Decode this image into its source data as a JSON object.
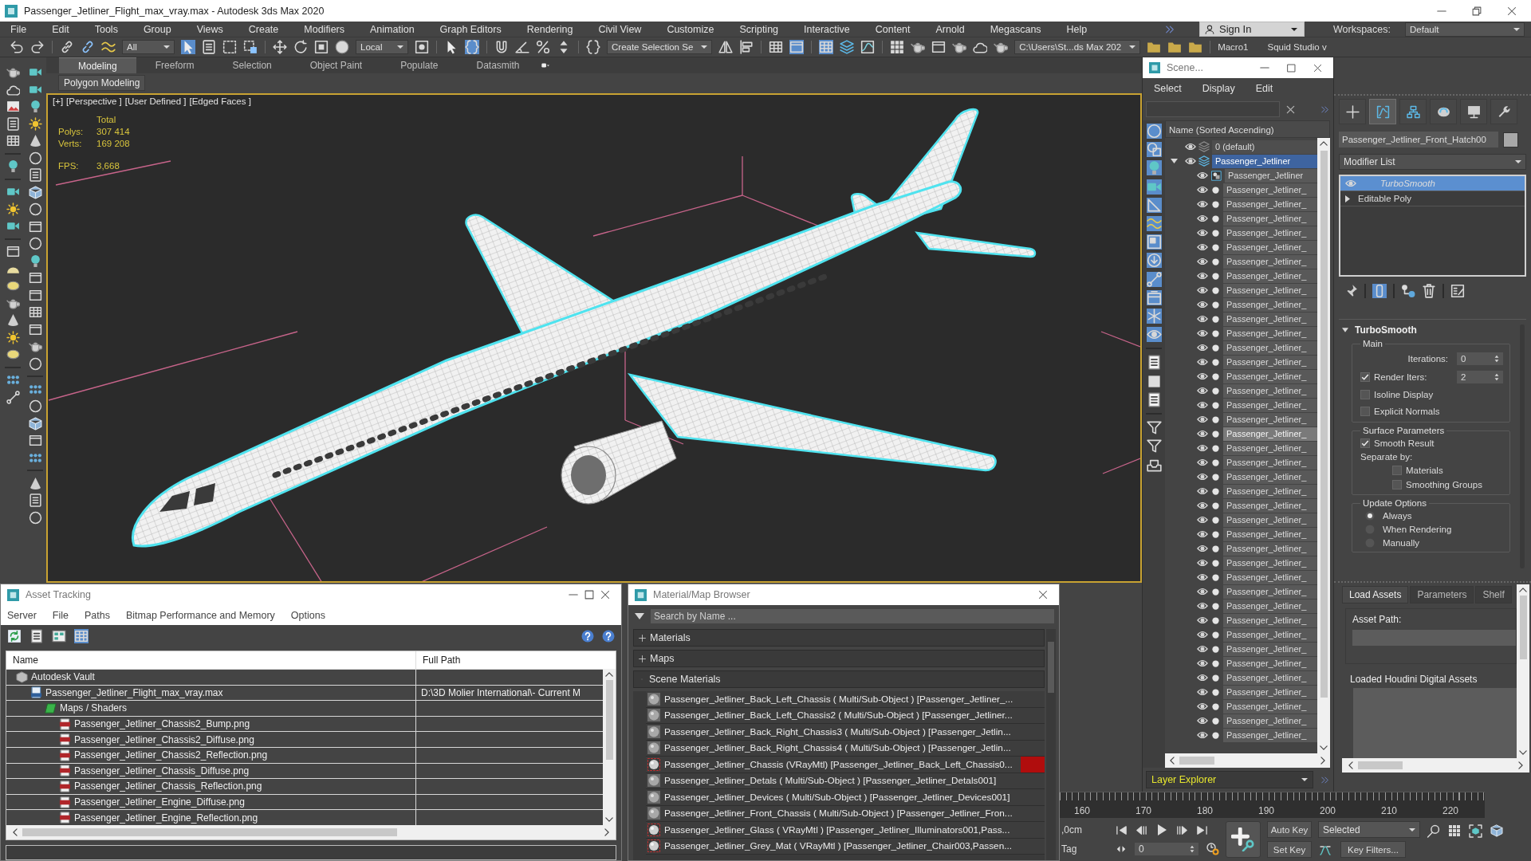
{
  "window": {
    "title": "Passenger_Jetliner_Flight_max_vray.max - Autodesk 3ds Max 2020"
  },
  "menu_bar": {
    "items": [
      "File",
      "Edit",
      "Tools",
      "Group",
      "Views",
      "Create",
      "Modifiers",
      "Animation",
      "Graph Editors",
      "Rendering",
      "Civil View",
      "Customize",
      "Scripting",
      "Interactive",
      "Content",
      "Arnold",
      "Megascans",
      "Help"
    ],
    "sign_in": "Sign In",
    "workspaces_label": "Workspaces:",
    "workspace": "Default"
  },
  "main_toolbar": {
    "items": [
      {
        "kind": "undo",
        "on": false
      },
      {
        "kind": "redo",
        "on": false
      },
      {
        "kind": "separator"
      },
      {
        "kind": "link",
        "on": false
      },
      {
        "kind": "unlink",
        "on": false
      },
      {
        "kind": "bind-space-warp",
        "on": false
      },
      {
        "kind": "dropdown",
        "value": "All"
      },
      {
        "kind": "select-object",
        "on": true
      },
      {
        "kind": "select-by-name",
        "on": false
      },
      {
        "kind": "rectangular-region",
        "on": false
      },
      {
        "kind": "window-crossing",
        "on": false
      },
      {
        "kind": "separator"
      },
      {
        "kind": "move",
        "on": false
      },
      {
        "kind": "rotate",
        "on": false
      },
      {
        "kind": "scale",
        "on": false
      },
      {
        "kind": "place",
        "on": false
      },
      {
        "kind": "dropdown",
        "value": "Local"
      },
      {
        "kind": "pivot",
        "on": false
      },
      {
        "kind": "separator"
      },
      {
        "kind": "manipulate",
        "on": false
      },
      {
        "kind": "keyboard-override",
        "on": true
      },
      {
        "kind": "separator"
      },
      {
        "kind": "snap",
        "on": false
      },
      {
        "kind": "angle-snap",
        "on": false
      },
      {
        "kind": "percent-snap",
        "on": false
      },
      {
        "kind": "spinner-snap",
        "on": false
      },
      {
        "kind": "separator"
      },
      {
        "kind": "named-selection",
        "on": false
      },
      {
        "kind": "dropdown",
        "value": "Create Selection Se"
      },
      {
        "kind": "mirror",
        "on": false
      },
      {
        "kind": "align",
        "on": false
      },
      {
        "kind": "separator"
      },
      {
        "kind": "layer-list",
        "on": false
      },
      {
        "kind": "ribbon-toggle",
        "on": true
      },
      {
        "kind": "separator"
      },
      {
        "kind": "scene-explorer",
        "on": true
      },
      {
        "kind": "layer-explorer",
        "on": false
      },
      {
        "kind": "curve-editor",
        "on": false
      },
      {
        "kind": "separator"
      },
      {
        "kind": "material-editor",
        "on": false
      },
      {
        "kind": "render-setup",
        "on": false
      },
      {
        "kind": "render-frame",
        "on": false
      },
      {
        "kind": "render",
        "on": false
      },
      {
        "kind": "render-cloud",
        "on": false
      },
      {
        "kind": "render-teapot",
        "on": false
      },
      {
        "kind": "dropdown",
        "value": "C:\\Users\\St...ds Max 202"
      },
      {
        "kind": "project-open",
        "on": false
      },
      {
        "kind": "project-save",
        "on": false
      },
      {
        "kind": "project-create",
        "on": false
      },
      {
        "kind": "separator"
      },
      {
        "kind": "text",
        "value": "Macro1"
      },
      {
        "kind": "text",
        "value": "Squid Studio v"
      }
    ]
  },
  "ribbon": {
    "tabs": [
      {
        "label": "Modeling",
        "selected": true
      },
      {
        "label": "Freeform",
        "selected": false
      },
      {
        "label": "Selection",
        "selected": false
      },
      {
        "label": "Object Paint",
        "selected": false
      },
      {
        "label": "Populate",
        "selected": false
      },
      {
        "label": "Datasmith",
        "selected": false
      }
    ],
    "panel_button": "Polygon Modeling"
  },
  "viewport": {
    "labels": [
      "[+]",
      "[Perspective ]",
      "[User Defined ]",
      "[Edged Faces ]"
    ],
    "stats": {
      "heading": "Total",
      "rows": [
        {
          "label": "Polys:",
          "value": "307 414"
        },
        {
          "label": "Verts:",
          "value": "169 208"
        }
      ],
      "fps_label": "FPS:",
      "fps_value": "3,668"
    }
  },
  "scene_explorer": {
    "title": "Scene...",
    "menu": [
      "Select",
      "Display",
      "Edit"
    ],
    "filters": [
      {
        "kind": "geometry",
        "on": true
      },
      {
        "kind": "shapes",
        "on": true
      },
      {
        "kind": "lights",
        "on": true
      },
      {
        "kind": "cameras",
        "on": true
      },
      {
        "kind": "helpers",
        "on": true
      },
      {
        "kind": "space-warps",
        "on": true
      },
      {
        "kind": "groups",
        "on": true
      },
      {
        "kind": "xrefs",
        "on": true
      },
      {
        "kind": "bones",
        "on": true
      },
      {
        "kind": "containers",
        "on": true
      },
      {
        "kind": "particles",
        "on": true
      },
      {
        "kind": "frozen",
        "on": true
      },
      {
        "kind": "separator"
      },
      {
        "kind": "display-children",
        "on": false
      },
      {
        "kind": "display-influences",
        "on": false
      },
      {
        "kind": "display-dependencies",
        "on": false
      },
      {
        "kind": "separator"
      },
      {
        "kind": "filter-off",
        "on": false
      },
      {
        "kind": "filter",
        "on": false
      },
      {
        "kind": "manage-layers",
        "on": false
      }
    ],
    "column_header": "Name (Sorted Ascending)",
    "layers": [
      {
        "name": "0 (default)",
        "selected": false,
        "expanded": false
      },
      {
        "name": "Passenger_Jetliner",
        "selected": true,
        "expanded": true,
        "children": [
          {
            "name": "Passenger_Jetliner",
            "kind": "group",
            "selected": false
          },
          {
            "name": "Passenger_Jetliner_",
            "kind": "object",
            "selected": false
          },
          {
            "name": "Passenger_Jetliner_",
            "kind": "object",
            "selected": false
          },
          {
            "name": "Passenger_Jetliner_",
            "kind": "object",
            "selected": false
          },
          {
            "name": "Passenger_Jetliner_",
            "kind": "object",
            "selected": false
          },
          {
            "name": "Passenger_Jetliner_",
            "kind": "object",
            "selected": false
          },
          {
            "name": "Passenger_Jetliner_",
            "kind": "object",
            "selected": false
          },
          {
            "name": "Passenger_Jetliner_",
            "kind": "object",
            "selected": false
          },
          {
            "name": "Passenger_Jetliner_",
            "kind": "object",
            "selected": false
          },
          {
            "name": "Passenger_Jetliner_",
            "kind": "object",
            "selected": false
          },
          {
            "name": "Passenger_Jetliner_",
            "kind": "object",
            "selected": false
          },
          {
            "name": "Passenger_Jetliner_",
            "kind": "object",
            "selected": false
          },
          {
            "name": "Passenger_Jetliner_",
            "kind": "object",
            "selected": false
          },
          {
            "name": "Passenger_Jetliner_",
            "kind": "object",
            "selected": false
          },
          {
            "name": "Passenger_Jetliner_",
            "kind": "object",
            "selected": false
          },
          {
            "name": "Passenger_Jetliner_",
            "kind": "object",
            "selected": false
          },
          {
            "name": "Passenger_Jetliner_",
            "kind": "object",
            "selected": false
          },
          {
            "name": "Passenger_Jetliner_",
            "kind": "object",
            "selected": false
          },
          {
            "name": "Passenger_Jetliner_",
            "kind": "object",
            "selected": true
          },
          {
            "name": "Passenger_Jetliner_",
            "kind": "object",
            "selected": false
          },
          {
            "name": "Passenger_Jetliner_",
            "kind": "object",
            "selected": false
          },
          {
            "name": "Passenger_Jetliner_",
            "kind": "object",
            "selected": false
          },
          {
            "name": "Passenger_Jetliner_",
            "kind": "object",
            "selected": false
          },
          {
            "name": "Passenger_Jetliner_",
            "kind": "object",
            "selected": false
          },
          {
            "name": "Passenger_Jetliner_",
            "kind": "object",
            "selected": false
          },
          {
            "name": "Passenger_Jetliner_",
            "kind": "object",
            "selected": false
          },
          {
            "name": "Passenger_Jetliner_",
            "kind": "object",
            "selected": false
          },
          {
            "name": "Passenger_Jetliner_",
            "kind": "object",
            "selected": false
          },
          {
            "name": "Passenger_Jetliner_",
            "kind": "object",
            "selected": false
          },
          {
            "name": "Passenger_Jetliner_",
            "kind": "object",
            "selected": false
          },
          {
            "name": "Passenger_Jetliner_",
            "kind": "object",
            "selected": false
          },
          {
            "name": "Passenger_Jetliner_",
            "kind": "object",
            "selected": false
          },
          {
            "name": "Passenger_Jetliner_",
            "kind": "object",
            "selected": false
          },
          {
            "name": "Passenger_Jetliner_",
            "kind": "object",
            "selected": false
          },
          {
            "name": "Passenger_Jetliner_",
            "kind": "object",
            "selected": false
          },
          {
            "name": "Passenger_Jetliner_",
            "kind": "object",
            "selected": false
          },
          {
            "name": "Passenger_Jetliner_",
            "kind": "object",
            "selected": false
          },
          {
            "name": "Passenger_Jetliner_",
            "kind": "object",
            "selected": false
          },
          {
            "name": "Passenger_Jetliner_",
            "kind": "object",
            "selected": false
          },
          {
            "name": "Passenger_Jetliner_",
            "kind": "object",
            "selected": false
          }
        ]
      }
    ],
    "footer": "Layer Explorer"
  },
  "command_panel": {
    "tabs": [
      {
        "kind": "create",
        "selected": false
      },
      {
        "kind": "modify",
        "selected": true
      },
      {
        "kind": "hierarchy",
        "selected": false
      },
      {
        "kind": "motion",
        "selected": false
      },
      {
        "kind": "display",
        "selected": false
      },
      {
        "kind": "utilities",
        "selected": false
      }
    ],
    "object_name": "Passenger_Jetliner_Front_Hatch00",
    "modifier_list": "Modifier List",
    "stack": [
      {
        "name": "TurboSmooth",
        "kind": "modifier",
        "selected": true
      },
      {
        "name": "Editable Poly",
        "kind": "base",
        "selected": false
      }
    ],
    "stack_tools": [
      {
        "kind": "pin",
        "on": false
      },
      {
        "kind": "end-result",
        "on": true
      },
      {
        "kind": "make-unique",
        "on": false
      },
      {
        "kind": "remove",
        "on": false
      },
      {
        "kind": "configure",
        "on": false
      }
    ],
    "rollout": {
      "title": "TurboSmooth",
      "groups": [
        {
          "title": "Main",
          "controls": [
            {
              "kind": "spinner",
              "label": "Iterations:",
              "value": "0"
            },
            {
              "kind": "checked-spinner",
              "label": "Render Iters:",
              "value": "2",
              "checked": true
            },
            {
              "kind": "checkbox",
              "label": "Isoline Display",
              "checked": false
            },
            {
              "kind": "checkbox",
              "label": "Explicit Normals",
              "checked": false
            }
          ]
        },
        {
          "title": "Surface Parameters",
          "controls": [
            {
              "kind": "checkbox",
              "label": "Smooth Result",
              "checked": true
            },
            {
              "kind": "label",
              "label": "Separate by:",
              "children": [
                {
                  "kind": "checkbox",
                  "label": "Materials",
                  "checked": false
                },
                {
                  "kind": "checkbox",
                  "label": "Smoothing Groups",
                  "checked": false
                }
              ]
            }
          ]
        },
        {
          "title": "Update Options",
          "controls": [
            {
              "kind": "radio",
              "label": "Always",
              "selected": true
            },
            {
              "kind": "radio",
              "label": "When Rendering",
              "selected": false
            },
            {
              "kind": "radio",
              "label": "Manually",
              "selected": false
            }
          ]
        }
      ]
    }
  },
  "houdini_panel": {
    "tabs": [
      {
        "label": "Load Assets",
        "selected": true
      },
      {
        "label": "Parameters",
        "selected": false
      },
      {
        "label": "Shelf",
        "selected": false
      }
    ],
    "asset_path_label": "Asset Path:",
    "loaded_assets_label": "Loaded Houdini Digital Assets"
  },
  "asset_tracking": {
    "title": "Asset Tracking",
    "menu": [
      "Server",
      "File",
      "Paths",
      "Bitmap Performance and Memory",
      "Options"
    ],
    "view_buttons": [
      {
        "kind": "refresh",
        "selected": false
      },
      {
        "kind": "list",
        "selected": false
      },
      {
        "kind": "thumbnails",
        "selected": false
      },
      {
        "kind": "table",
        "selected": true
      }
    ],
    "columns": [
      "Name",
      "Full Path"
    ],
    "rows": [
      {
        "name": "Autodesk Vault",
        "kind": "vault",
        "children": [
          {
            "name": "Passenger_Jetliner_Flight_max_vray.max",
            "kind": "max-file",
            "path": "D:\\3D Molier International\\- Current M",
            "children": [
              {
                "name": "Maps / Shaders",
                "kind": "maps",
                "children": [
                  {
                    "name": "Passenger_Jetliner_Chassis2_Bump.png",
                    "kind": "png"
                  },
                  {
                    "name": "Passenger_Jetliner_Chassis2_Diffuse.png",
                    "kind": "png"
                  },
                  {
                    "name": "Passenger_Jetliner_Chassis2_Reflection.png",
                    "kind": "png"
                  },
                  {
                    "name": "Passenger_Jetliner_Chassis_Diffuse.png",
                    "kind": "png"
                  },
                  {
                    "name": "Passenger_Jetliner_Chassis_Reflection.png",
                    "kind": "png"
                  },
                  {
                    "name": "Passenger_Jetliner_Engine_Diffuse.png",
                    "kind": "png"
                  },
                  {
                    "name": "Passenger_Jetliner_Engine_Reflection.png",
                    "kind": "png"
                  }
                ]
              }
            ]
          }
        ]
      }
    ]
  },
  "material_browser": {
    "title": "Material/Map Browser",
    "search_placeholder": "Search by Name ...",
    "groups": [
      {
        "label": "Materials",
        "expanded": false
      },
      {
        "label": "Maps",
        "expanded": false
      },
      {
        "label": "Scene Materials",
        "expanded": true,
        "items": [
          {
            "label": "Passenger_Jetliner_Back_Left_Chassis ( Multi/Sub-Object ) [Passenger_Jetliner_...",
            "kind": "multi",
            "flagged": false
          },
          {
            "label": "Passenger_Jetliner_Back_Left_Chassis2 ( Multi/Sub-Object ) [Passenger_Jetliner...",
            "kind": "multi",
            "flagged": false
          },
          {
            "label": "Passenger_Jetliner_Back_Right_Chassis3 ( Multi/Sub-Object ) [Passenger_Jetlin...",
            "kind": "multi",
            "flagged": false
          },
          {
            "label": "Passenger_Jetliner_Back_Right_Chassis4 ( Multi/Sub-Object ) [Passenger_Jetlin...",
            "kind": "multi",
            "flagged": false
          },
          {
            "label": "Passenger_Jetliner_Chassis (VRayMtl) [Passenger_Jetliner_Back_Left_Chassis0...",
            "kind": "vray",
            "flagged": true
          },
          {
            "label": "Passenger_Jetliner_Detals ( Multi/Sub-Object ) [Passenger_Jetliner_Detals001]",
            "kind": "multi",
            "flagged": false
          },
          {
            "label": "Passenger_Jetliner_Devices ( Multi/Sub-Object ) [Passenger_Jetliner_Devices001]",
            "kind": "multi",
            "flagged": false
          },
          {
            "label": "Passenger_Jetliner_Front_Chassis ( Multi/Sub-Object ) [Passenger_Jetliner_Fron...",
            "kind": "multi",
            "flagged": false
          },
          {
            "label": "Passenger_Jetliner_Glass ( VRayMtl ) [Passenger_Jetliner_Illuminators001,Pass...",
            "kind": "vray",
            "flagged": false
          },
          {
            "label": "Passenger_Jetliner_Grey_Mat ( VRayMtl ) [Passenger_Jetliner_Chair003,Passen...",
            "kind": "vray",
            "flagged": false
          }
        ]
      }
    ]
  },
  "time_slider": {
    "labels": [
      "160",
      "170",
      "180",
      "190",
      "200",
      "210",
      "220"
    ]
  },
  "animation_controls": {
    "coordinate_fragment": ",0cm",
    "tag_label": "Tag",
    "frame": "0",
    "auto_key": "Auto Key",
    "key_mode": "Selected",
    "set_key": "Set Key",
    "key_filters": "Key Filters..."
  }
}
